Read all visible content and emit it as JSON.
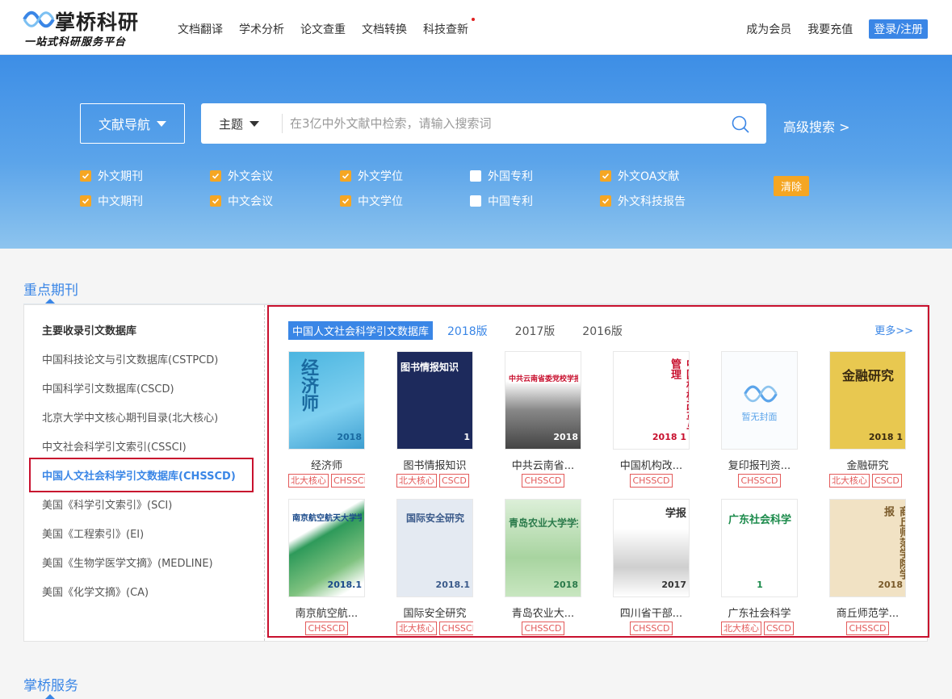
{
  "header": {
    "logo_title": "掌桥科研",
    "logo_subtitle": "一站式科研服务平台",
    "nav": [
      "文档翻译",
      "学术分析",
      "论文查重",
      "文档转换",
      "科技查新"
    ],
    "member": "成为会员",
    "recharge": "我要充值",
    "login": "登录/注册"
  },
  "search": {
    "nav_button": "文献导航",
    "field": "主题",
    "placeholder": "在3亿中外文献中检索，请输入搜索词",
    "advanced": "高级搜索  >",
    "clear": "清除",
    "checks": [
      {
        "label": "外文期刊",
        "checked": true
      },
      {
        "label": "外文会议",
        "checked": true
      },
      {
        "label": "外文学位",
        "checked": true
      },
      {
        "label": "外国专利",
        "checked": false
      },
      {
        "label": "外文OA文献",
        "checked": true
      },
      {
        "label": "中文期刊",
        "checked": true
      },
      {
        "label": "中文会议",
        "checked": true
      },
      {
        "label": "中文学位",
        "checked": true
      },
      {
        "label": "中国专利",
        "checked": false
      },
      {
        "label": "外文科技报告",
        "checked": true
      }
    ]
  },
  "journals": {
    "section_title": "重点期刊",
    "sidebar_heading": "主要收录引文数据库",
    "sidebar": [
      "中国科技论文与引文数据库(CSTPCD)",
      "中国科学引文数据库(CSCD)",
      "北京大学中文核心期刊目录(北大核心)",
      "中文社会科学引文索引(CSSCI)",
      "中国人文社会科学引文数据库(CHSSCD)",
      "美国《科学引文索引》(SCI)",
      "美国《工程索引》(EI)",
      "美国《生物学医学文摘》(MEDLINE)",
      "美国《化学文摘》(CA)"
    ],
    "active_tab": "中国人文社会科学引文数据库",
    "years": [
      "2018版",
      "2017版",
      "2016版"
    ],
    "more": "更多>>",
    "no_cover_text": "暂无封面",
    "books": [
      {
        "name": "经济师",
        "tags": [
          "北大核心",
          "CHSSCD"
        ],
        "cover_text": "经济师",
        "cover_year": "2018"
      },
      {
        "name": "图书情报知识",
        "tags": [
          "北大核心",
          "CSCD"
        ],
        "cover_text": "图书情报知识",
        "cover_year": "1"
      },
      {
        "name": "中共云南省...",
        "tags": [
          "CHSSCD"
        ],
        "cover_text": "中共云南省委党校学报",
        "cover_year": "2018"
      },
      {
        "name": "中国机构改...",
        "tags": [
          "CHSSCD"
        ],
        "cover_text": "中国机构改革与管理",
        "cover_year": "2018 1"
      },
      {
        "name": "复印报刊资...",
        "tags": [
          "CHSSCD"
        ],
        "cover_text": "",
        "cover_year": ""
      },
      {
        "name": "金融研究",
        "tags": [
          "北大核心",
          "CSCD"
        ],
        "cover_text": "金融研究",
        "cover_year": "2018 1"
      },
      {
        "name": "南京航空航...",
        "tags": [
          "CHSSCD"
        ],
        "cover_text": "南京航空航天大学学报",
        "cover_year": "2018.1"
      },
      {
        "name": "国际安全研究",
        "tags": [
          "北大核心",
          "CHSSCD"
        ],
        "cover_text": "国际安全研究",
        "cover_year": "2018.1"
      },
      {
        "name": "青岛农业大...",
        "tags": [
          "CHSSCD"
        ],
        "cover_text": "青岛农业大学学报",
        "cover_year": "2018"
      },
      {
        "name": "四川省干部...",
        "tags": [
          "CHSSCD"
        ],
        "cover_text": "学报",
        "cover_year": "2017"
      },
      {
        "name": "广东社会科学",
        "tags": [
          "北大核心",
          "CSCD"
        ],
        "cover_text": "广东社会科学",
        "cover_year": "1"
      },
      {
        "name": "商丘师范学...",
        "tags": [
          "CHSSCD"
        ],
        "cover_text": "商丘师范学院学报",
        "cover_year": "2018"
      }
    ]
  },
  "services": {
    "section_title": "掌桥服务"
  }
}
